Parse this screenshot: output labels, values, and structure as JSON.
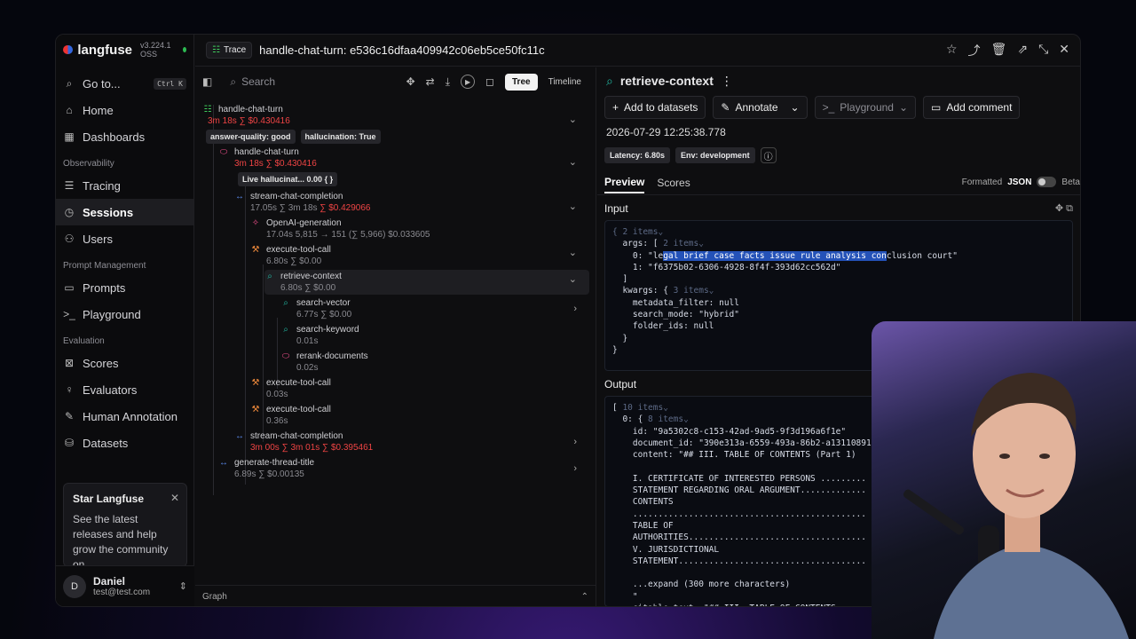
{
  "brand": {
    "name": "langfuse",
    "version": "v3.224.1 OSS"
  },
  "sidebar": {
    "goto": {
      "label": "Go to...",
      "kbd": "Ctrl K"
    },
    "items_top": [
      {
        "label": "Home",
        "icon": "home-icon"
      },
      {
        "label": "Dashboards",
        "icon": "dashboard-icon"
      }
    ],
    "section_observability": "Observability",
    "items_obs": [
      {
        "label": "Tracing",
        "icon": "tracing-icon"
      },
      {
        "label": "Sessions",
        "icon": "sessions-icon"
      },
      {
        "label": "Users",
        "icon": "users-icon"
      }
    ],
    "section_prompt": "Prompt Management",
    "items_prompt": [
      {
        "label": "Prompts",
        "icon": "prompts-icon"
      },
      {
        "label": "Playground",
        "icon": "playground-icon"
      }
    ],
    "section_eval": "Evaluation",
    "items_eval": [
      {
        "label": "Scores",
        "icon": "scores-icon"
      },
      {
        "label": "Evaluators",
        "icon": "evaluators-icon"
      },
      {
        "label": "Human Annotation",
        "icon": "annotation-icon"
      },
      {
        "label": "Datasets",
        "icon": "datasets-icon"
      }
    ],
    "star": {
      "title": "Star Langfuse",
      "desc": "See the latest releases and help grow the community on"
    },
    "user": {
      "initial": "D",
      "name": "Daniel",
      "email": "test@test.com"
    }
  },
  "header": {
    "badge": "Trace",
    "title": "handle-chat-turn: e536c16dfaa409942c06eb5ce50fc11c"
  },
  "tree": {
    "search_placeholder": "Search",
    "view_tree": "Tree",
    "view_timeline": "Timeline",
    "graph_label": "Graph",
    "nodes": {
      "n0": {
        "name": "handle-chat-turn",
        "meta": "3m 18s  ∑ $0.430416",
        "pills": [
          "answer-quality: good",
          "hallucination: True"
        ]
      },
      "n1": {
        "name": "handle-chat-turn",
        "meta": "3m 18s  ∑ $0.430416",
        "pill": "Live hallucinat...  0.00",
        "pill_extra": "{ }"
      },
      "n2": {
        "name": "stream-chat-completion",
        "meta_a": "17.05s  ∑ 3m 18s",
        "meta_b": "∑ $0.429066"
      },
      "n3": {
        "name": "OpenAI-generation",
        "meta": "17.04s  5,815 → 151 (∑ 5,966)  $0.033605"
      },
      "n4": {
        "name": "execute-tool-call",
        "meta": "6.80s  ∑ $0.00"
      },
      "n5": {
        "name": "retrieve-context",
        "meta": "6.80s  ∑ $0.00"
      },
      "n6": {
        "name": "search-vector",
        "meta": "6.77s  ∑ $0.00"
      },
      "n7": {
        "name": "search-keyword",
        "meta": "0.01s"
      },
      "n8": {
        "name": "rerank-documents",
        "meta": "0.02s"
      },
      "n9": {
        "name": "execute-tool-call",
        "meta": "0.03s"
      },
      "n10": {
        "name": "execute-tool-call",
        "meta": "0.36s"
      },
      "n11": {
        "name": "stream-chat-completion",
        "meta": "3m 00s  ∑ 3m 01s  ∑ $0.395461"
      },
      "n12": {
        "name": "generate-thread-title",
        "meta": "6.89s  ∑ $0.00135"
      }
    }
  },
  "detail": {
    "name": "retrieve-context",
    "actions": {
      "add_dataset": "Add to datasets",
      "annotate": "Annotate",
      "playground": "Playground",
      "comment": "Add comment"
    },
    "timestamp": "2026-07-29 12:25:38.778",
    "chips": [
      "Latency: 6.80s",
      "Env: development"
    ],
    "tabs": {
      "preview": "Preview",
      "scores": "Scores"
    },
    "format": {
      "formatted": "Formatted",
      "json": "JSON",
      "beta": "Beta"
    },
    "input_label": "Input",
    "output_label": "Output"
  }
}
